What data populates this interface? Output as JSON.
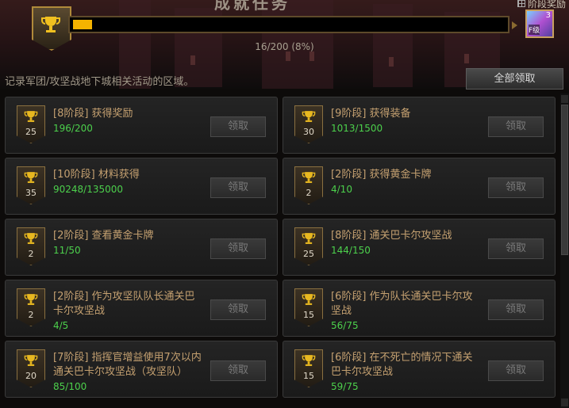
{
  "header": {
    "title": "成就任务",
    "stage_reward_label": "阶段奖励",
    "progress_current": 16,
    "progress_max": 200,
    "progress_fraction": 0.08,
    "progress_text": "16/200 (8%)",
    "reward_item": {
      "count": "3",
      "label": "F级"
    },
    "accent_color": "#f5b300"
  },
  "description": "记录军团/攻坚战地下城相关活动的区域。",
  "claim_all_label": "全部领取",
  "cards": [
    {
      "title": "[8阶段] 获得奖励",
      "progress": "196/200",
      "points": "25",
      "button": "领取"
    },
    {
      "title": "[9阶段] 获得装备",
      "progress": "1013/1500",
      "points": "30",
      "button": "领取"
    },
    {
      "title": "[10阶段] 材料获得",
      "progress": "90248/135000",
      "points": "35",
      "button": "领取"
    },
    {
      "title": "[2阶段] 获得黄金卡牌",
      "progress": "4/10",
      "points": "2",
      "button": "领取"
    },
    {
      "title": "[2阶段] 查看黄金卡牌",
      "progress": "11/50",
      "points": "2",
      "button": "领取"
    },
    {
      "title": "[8阶段] 通关巴卡尔攻坚战",
      "progress": "144/150",
      "points": "25",
      "button": "领取"
    },
    {
      "title": "[2阶段] 作为攻坚队队长通关巴卡尔攻坚战",
      "progress": "4/5",
      "points": "2",
      "button": "领取"
    },
    {
      "title": "[6阶段] 作为队长通关巴卡尔攻坚战",
      "progress": "56/75",
      "points": "15",
      "button": "领取"
    },
    {
      "title": "[7阶段] 指挥官增益使用7次以内通关巴卡尔攻坚战（攻坚队）",
      "progress": "85/100",
      "points": "20",
      "button": "领取"
    },
    {
      "title": "[6阶段] 在不死亡的情况下通关巴卡尔攻坚战",
      "progress": "59/75",
      "points": "15",
      "button": "领取"
    }
  ],
  "icons": {
    "trophy": "trophy-icon"
  }
}
